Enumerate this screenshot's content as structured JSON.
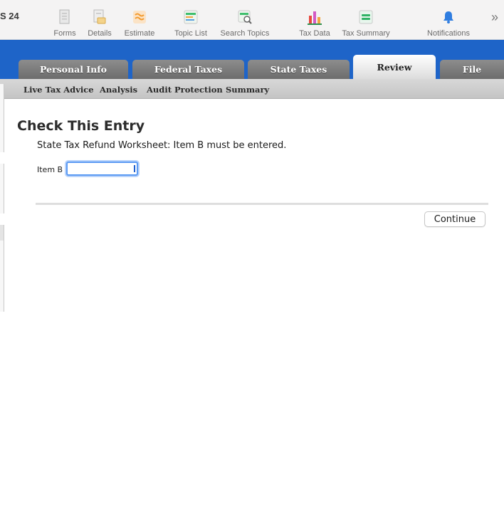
{
  "app": {
    "title_fragment": "S 24"
  },
  "toolbar": {
    "items": [
      {
        "label": "Forms",
        "icon": "forms-icon"
      },
      {
        "label": "Details",
        "icon": "details-icon"
      },
      {
        "label": "Estimate",
        "icon": "estimate-icon"
      },
      {
        "label": "Topic List",
        "icon": "topic-list-icon"
      },
      {
        "label": "Search Topics",
        "icon": "search-topics-icon"
      },
      {
        "label": "Tax Data",
        "icon": "tax-data-icon"
      },
      {
        "label": "Tax Summary",
        "icon": "tax-summary-icon"
      },
      {
        "label": "Notifications",
        "icon": "bell-icon"
      }
    ],
    "overflow": "»"
  },
  "tabs": [
    {
      "label": "Personal Info",
      "active": false
    },
    {
      "label": "Federal Taxes",
      "active": false
    },
    {
      "label": "State Taxes",
      "active": false
    },
    {
      "label": "Review",
      "active": true
    },
    {
      "label": "File",
      "active": false
    }
  ],
  "subnav": [
    {
      "label": "Live Tax Advice"
    },
    {
      "label": "Analysis"
    },
    {
      "label": "Audit Protection"
    },
    {
      "label": "Summary"
    }
  ],
  "content": {
    "heading": "Check This Entry",
    "message": "State Tax Refund Worksheet: Item B must be entered.",
    "field_label": "Item B",
    "field_value": "",
    "continue_label": "Continue"
  },
  "colors": {
    "accent_blue": "#1e64c8",
    "focus_ring": "#5b9af3"
  }
}
